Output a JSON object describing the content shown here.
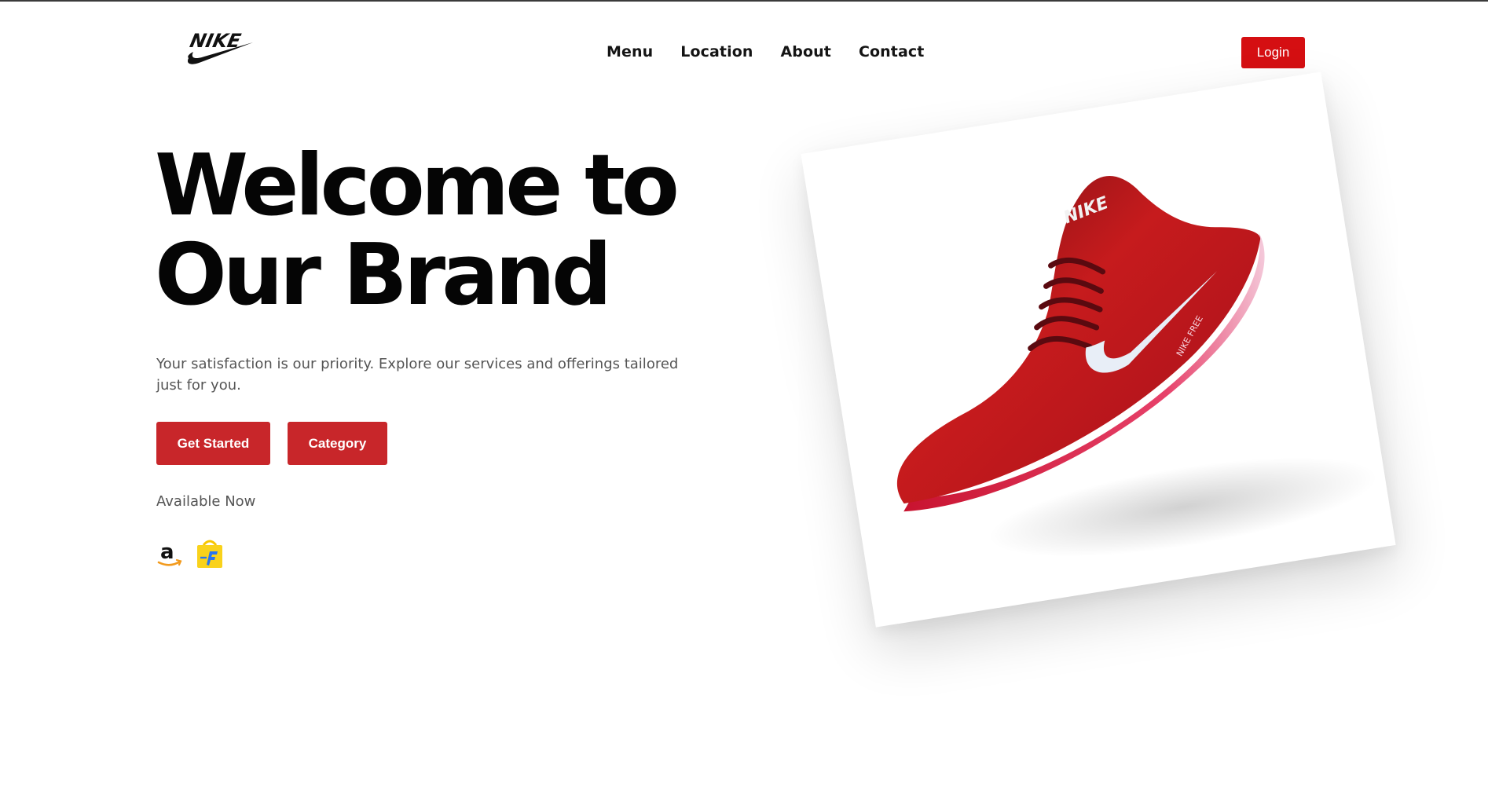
{
  "header": {
    "brand_logo_text": "NIKE",
    "nav": [
      "Menu",
      "Location",
      "About",
      "Contact"
    ],
    "login_label": "Login"
  },
  "hero": {
    "title_line1": "Welcome to",
    "title_line2": "Our Brand",
    "subtitle": "Your satisfaction is our priority. Explore our services and offerings tailored just for you.",
    "buttons": {
      "get_started": "Get Started",
      "category": "Category"
    },
    "available_label": "Available Now",
    "stores": [
      "amazon-icon",
      "flipkart-icon"
    ]
  },
  "product": {
    "shoe_tongue_text": "NIKE",
    "shoe_side_text": "NIKE FREE"
  },
  "colors": {
    "accent": "#c8262a",
    "login": "#d50f12",
    "text_dark": "#050505",
    "text_muted": "#555555"
  }
}
